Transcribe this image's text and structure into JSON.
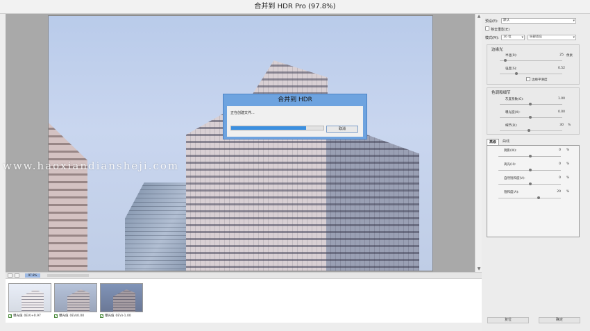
{
  "window": {
    "title": "合并到 HDR Pro (97.8%)"
  },
  "preview": {
    "watermark": "www.haoxiandiansheji.com"
  },
  "dialog": {
    "title": "合并到 HDR",
    "message": "正在创建文件...",
    "progress": 0.81,
    "cancel_label": "取消"
  },
  "zoom_bar": {
    "zoom_value": "97.8%"
  },
  "filmstrip": {
    "items": [
      {
        "label": "曝光值",
        "ev": "0EV)+0.97",
        "checked": true
      },
      {
        "label": "曝光值",
        "ev": "0EV)0.00",
        "checked": true
      },
      {
        "label": "曝光值",
        "ev": "0EV)-1.00",
        "checked": true
      }
    ]
  },
  "panel": {
    "preset_label": "预设(E):",
    "preset_value": "默认",
    "remove_ghosts_label": "移去重影(E)",
    "mode_label": "模式(M):",
    "mode_bits": "16 位",
    "mode_method": "局部适应",
    "edge_glow": {
      "title": "边缘光",
      "radius_label": "半径(R):",
      "radius_value": "25",
      "radius_unit": "像素",
      "strength_label": "强度(S):",
      "strength_value": "0.52",
      "smooth_edges_label": "边缘平滑度"
    },
    "tone_detail": {
      "title": "色调和细节",
      "gamma_label": "灰度系数(G):",
      "gamma_value": "1.00",
      "exposure_label": "曝光度(X):",
      "exposure_value": "0.00",
      "detail_label": "细节(D):",
      "detail_value": "30",
      "detail_unit": "%"
    },
    "tabs": {
      "advanced": "高级",
      "curve": "曲线"
    },
    "advanced": {
      "shadow_label": "阴影(W):",
      "shadow_value": "0",
      "highlight_label": "高光(H):",
      "highlight_value": "0",
      "vibrance_label": "自然饱和度(V):",
      "vibrance_value": "0",
      "saturation_label": "饱和度(A):",
      "saturation_value": "20",
      "unit": "%"
    },
    "reset_label": "复位",
    "ok_label": "确定"
  }
}
